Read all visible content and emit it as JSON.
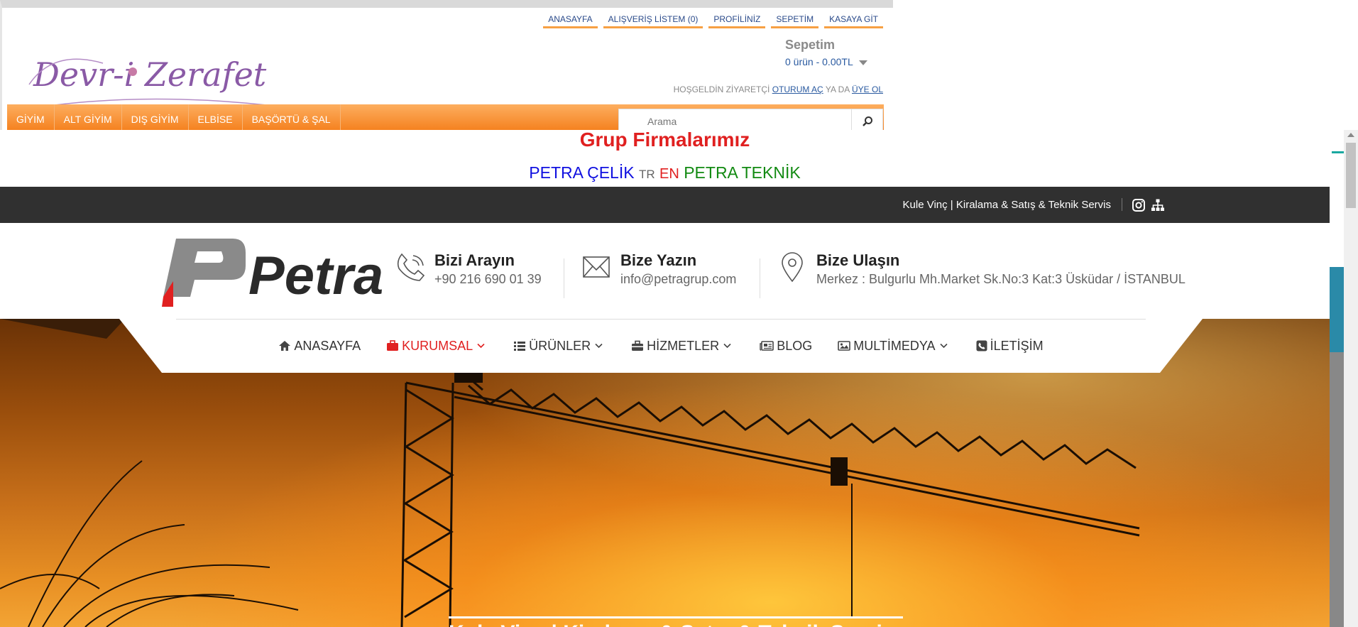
{
  "overlay": {
    "top_nav": [
      "ANASAYFA",
      "ALIŞVERİŞ LİSTEM (0)",
      "PROFİLİNİZ",
      "SEPETİM",
      "KASAYA GİT"
    ],
    "logo_text": "Devr-i Zerafet",
    "cart": {
      "title": "Sepetim",
      "summary": "0 ürün - 0.00TL"
    },
    "welcome": {
      "prefix": "HOŞGELDİN ZİYARETÇİ",
      "login": "OTURUM AÇ",
      "middle": "YA DA",
      "register": "ÜYE OL"
    },
    "menu": [
      "GİYİM",
      "ALT GİYİM",
      "DIŞ GİYİM",
      "ELBİSE",
      "BAŞÖRTÜ & ŞAL"
    ],
    "search_placeholder": "Arama",
    "colors": {
      "accent": "#f47d19",
      "link": "#2a4a8a"
    }
  },
  "group": {
    "title": "Grup Firmalarımız",
    "link1": "PETRA ÇELİK",
    "tr": "TR",
    "en": "EN",
    "link2": "PETRA TEKNİK"
  },
  "topbar": {
    "tagline": "Kule Vinç | Kiralama & Satış & Teknik Servis",
    "icons": [
      "instagram-icon",
      "sitemap-icon"
    ]
  },
  "header": {
    "logo_text": "Petra",
    "call": {
      "title": "Bizi Arayın",
      "value": "+90 216 690 01 39"
    },
    "mail": {
      "title": "Bize Yazın",
      "value": "info@petragrup.com"
    },
    "address": {
      "title": "Bize Ulaşın",
      "value": "Merkez : Bulgurlu Mh.Market Sk.No:3 Kat:3 Üsküdar / İSTANBUL"
    }
  },
  "nav": [
    {
      "label": "ANASAYFA",
      "icon": "home-icon",
      "dropdown": false,
      "active": false
    },
    {
      "label": "KURUMSAL",
      "icon": "briefcase-icon",
      "dropdown": true,
      "active": true
    },
    {
      "label": "ÜRÜNLER",
      "icon": "list-icon",
      "dropdown": true,
      "active": false
    },
    {
      "label": "HİZMETLER",
      "icon": "toolbox-icon",
      "dropdown": true,
      "active": false
    },
    {
      "label": "BLOG",
      "icon": "newspaper-icon",
      "dropdown": false,
      "active": false
    },
    {
      "label": "MULTİMEDYA",
      "icon": "image-icon",
      "dropdown": true,
      "active": false
    },
    {
      "label": "İLETİŞİM",
      "icon": "phone-square-icon",
      "dropdown": false,
      "active": false
    }
  ],
  "hero": {
    "title": "Kule Vinç | Kiralama & Satış & Teknik Servis"
  },
  "colors": {
    "brand_red": "#e02020",
    "dark_bar": "#303030"
  }
}
